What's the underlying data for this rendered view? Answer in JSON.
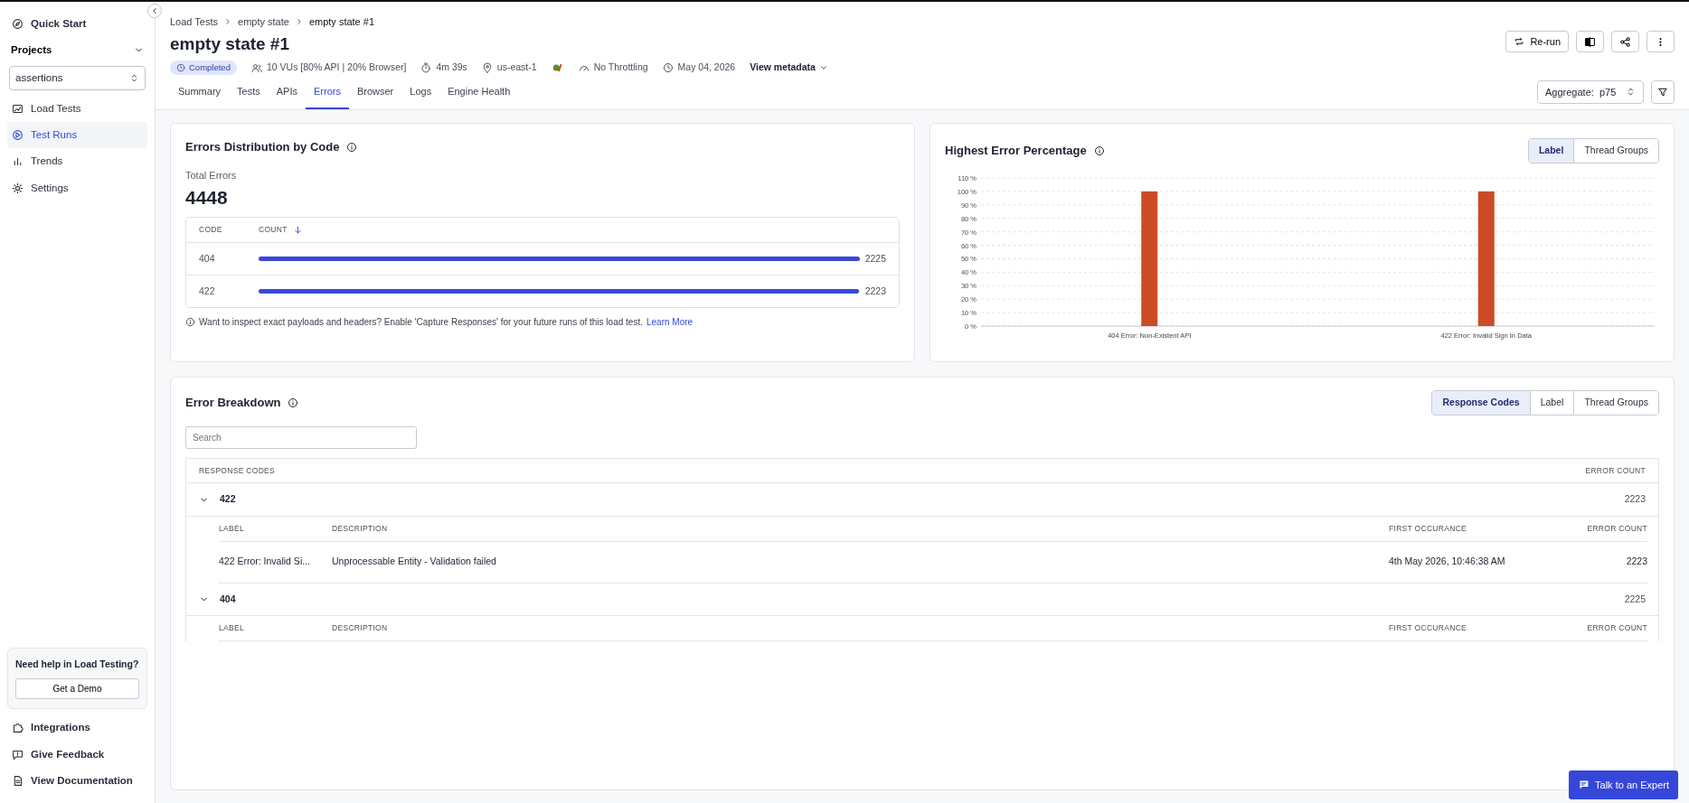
{
  "sidebar": {
    "top_items": [
      {
        "label": "Quick Start"
      }
    ],
    "projects": {
      "title": "Projects",
      "expanded": true,
      "select_value": "assertions"
    },
    "items": [
      {
        "label": "Load Tests",
        "selected": false
      },
      {
        "label": "Test Runs",
        "selected": true
      },
      {
        "label": "Trends",
        "selected": false
      },
      {
        "label": "Settings",
        "selected": false
      }
    ],
    "help": {
      "title": "Need help in Load Testing?",
      "button": "Get a Demo"
    },
    "bottom_items": [
      {
        "label": "Integrations"
      },
      {
        "label": "Give Feedback"
      },
      {
        "label": "View Documentation"
      }
    ]
  },
  "breadcrumb": [
    "Load Tests",
    "empty state",
    "empty state #1"
  ],
  "title": "empty state #1",
  "meta": {
    "status": "Completed",
    "vus": "10 VUs [80% API | 20% Browser]",
    "duration": "4m 39s",
    "region": "us-east-1",
    "throttling": "No Throttling",
    "date": "May 04, 2026",
    "view_metadata": "View metadata"
  },
  "actions": {
    "rerun": "Re-run"
  },
  "tabs": [
    {
      "label": "Summary",
      "selected": false
    },
    {
      "label": "Tests",
      "selected": false
    },
    {
      "label": "APIs",
      "selected": false
    },
    {
      "label": "Errors",
      "selected": true
    },
    {
      "label": "Browser",
      "selected": false
    },
    {
      "label": "Logs",
      "selected": false
    },
    {
      "label": "Engine Health",
      "selected": false
    }
  ],
  "aggregate": {
    "label": "Aggregate:",
    "value": "p75"
  },
  "distribution": {
    "title": "Errors Distribution by Code",
    "total_label": "Total Errors",
    "total": "4448",
    "columns": [
      "CODE",
      "COUNT"
    ],
    "rows": [
      {
        "code": "404",
        "count": "2225",
        "level": 1
      },
      {
        "code": "422",
        "count": "2223",
        "level": 0.999
      }
    ],
    "note": "Want to inspect exact payloads and headers? Enable 'Capture Responses' for your future runs of this load test.",
    "note_link": "Learn More"
  },
  "highest": {
    "title": "Highest Error Percentage",
    "options": [
      {
        "label": "Label",
        "selected": true
      },
      {
        "label": "Thread Groups",
        "selected": false
      }
    ],
    "chart_data": {
      "type": "bar",
      "categories": [
        "404 Error: Non-Existent API",
        "422 Error: Invalid Sign In Data"
      ],
      "series": [
        {
          "color": "#cc4b24",
          "values": [
            100,
            100
          ]
        }
      ],
      "ylim": [
        0,
        110
      ],
      "grid": true,
      "yticks": [
        {
          "value": 0,
          "label": "0 %"
        },
        {
          "value": 10,
          "label": "10 %"
        },
        {
          "value": 20,
          "label": "20 %"
        },
        {
          "value": 30,
          "label": "30 %"
        },
        {
          "value": 40,
          "label": "40 %"
        },
        {
          "value": 50,
          "label": "50 %"
        },
        {
          "value": 60,
          "label": "60 %"
        },
        {
          "value": 70,
          "label": "70 %"
        },
        {
          "value": 80,
          "label": "80 %"
        },
        {
          "value": 90,
          "label": "90 %"
        },
        {
          "value": 100,
          "label": "100 %"
        },
        {
          "value": 110,
          "label": "110 %"
        }
      ]
    }
  },
  "breakdown": {
    "title": "Error Breakdown",
    "options": [
      {
        "label": "Response Codes",
        "selected": true
      },
      {
        "label": "Label",
        "selected": false
      },
      {
        "label": "Thread Groups",
        "selected": false
      }
    ],
    "search_placeholder": "Search",
    "columns": [
      "RESPONSE CODES",
      "ERROR COUNT"
    ],
    "groups": [
      {
        "code": "422",
        "count": "2223",
        "expanded": true,
        "columns": [
          "LABEL",
          "DESCRIPTION",
          "FIRST OCCURANCE",
          "ERROR COUNT"
        ],
        "rows": [
          {
            "label": "422 Error: Invalid Si...",
            "description": "Unprocessable Entity - Validation failed",
            "first": "4th May 2026, 10:46:38 AM",
            "count": "2223"
          }
        ]
      },
      {
        "code": "404",
        "count": "2225",
        "expanded": true,
        "columns": [
          "LABEL",
          "DESCRIPTION",
          "FIRST OCCURANCE",
          "ERROR COUNT"
        ]
      }
    ]
  },
  "expert_button": "Talk to an Expert"
}
